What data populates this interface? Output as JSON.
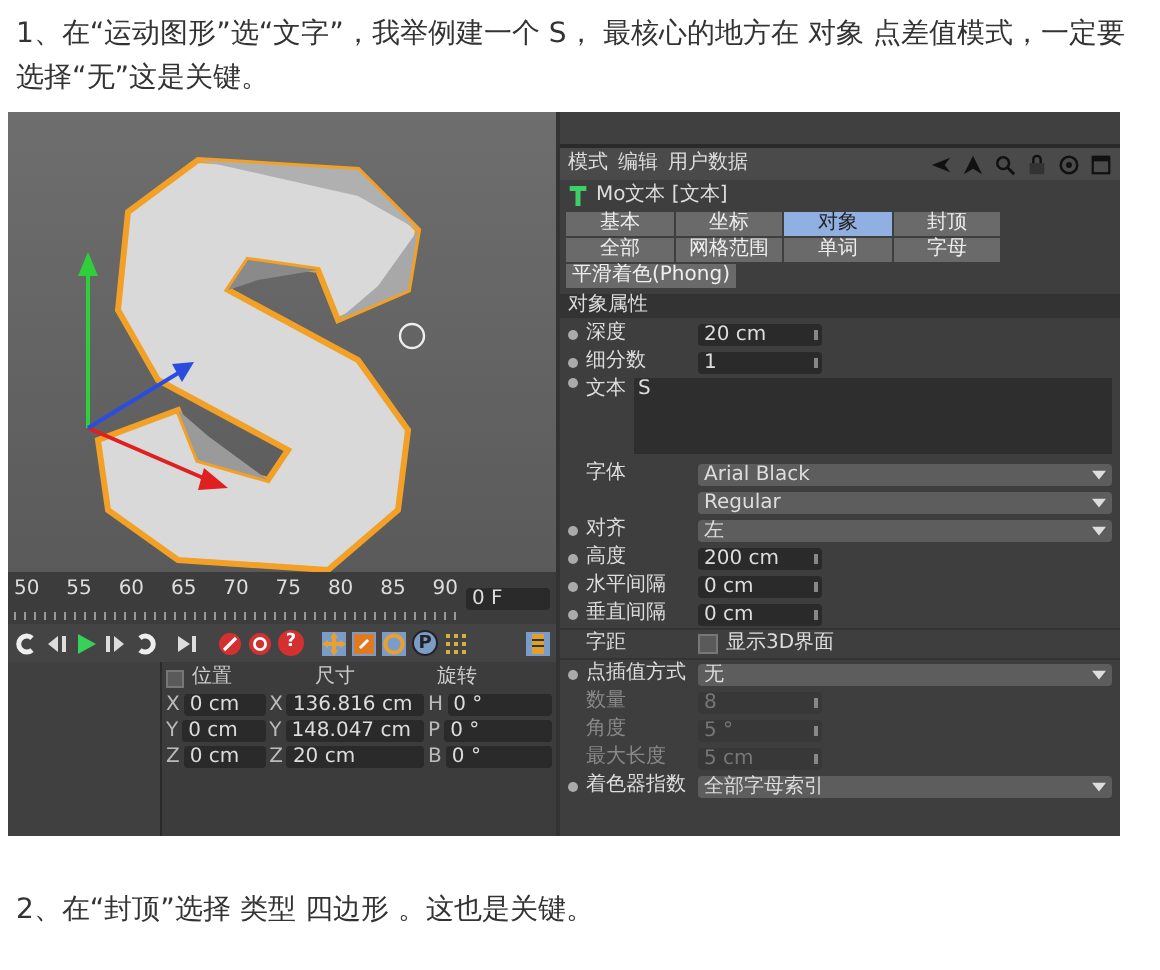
{
  "intro": "1、在“运动图形”选“文字”，我举例建一个 S， 最核心的地方在 对象 点差值模式，一定要选择“无”这是关键。",
  "timeline": {
    "ticks": [
      "50",
      "55",
      "60",
      "65",
      "70",
      "75",
      "80",
      "85",
      "90"
    ],
    "frame": "0 F"
  },
  "transport": {
    "help": "?",
    "param": "P"
  },
  "coords": {
    "checked": false,
    "headers": [
      "位置",
      "尺寸",
      "旋转"
    ],
    "rows": [
      [
        {
          "axis": "X",
          "value": "0 cm"
        },
        {
          "axis": "X",
          "value": "136.816 cm"
        },
        {
          "axis": "H",
          "value": "0 °"
        }
      ],
      [
        {
          "axis": "Y",
          "value": "0 cm"
        },
        {
          "axis": "Y",
          "value": "148.047 cm"
        },
        {
          "axis": "P",
          "value": "0 °"
        }
      ],
      [
        {
          "axis": "Z",
          "value": "0 cm"
        },
        {
          "axis": "Z",
          "value": "20 cm"
        },
        {
          "axis": "B",
          "value": "0 °"
        }
      ]
    ]
  },
  "attributes": {
    "menu": [
      "模式",
      "编辑",
      "用户数据"
    ],
    "object_title": "Mo文本 [文本]",
    "tabs": [
      {
        "label": "基本",
        "selected": false
      },
      {
        "label": "坐标",
        "selected": false
      },
      {
        "label": "对象",
        "selected": true
      },
      {
        "label": "封顶",
        "selected": false
      },
      {
        "label": "全部",
        "selected": false
      },
      {
        "label": "网格范围",
        "selected": false
      },
      {
        "label": "单词",
        "selected": false
      },
      {
        "label": "字母",
        "selected": false
      }
    ],
    "extra_tab": {
      "label": "平滑着色(Phong)",
      "selected": false
    },
    "section": "对象属性",
    "rows": [
      {
        "kind": "number",
        "label": "深度",
        "value": "20 cm",
        "dot": true,
        "disabled": false
      },
      {
        "kind": "number",
        "label": "细分数",
        "value": "1",
        "dot": true,
        "disabled": false
      },
      {
        "kind": "text",
        "label": "文本",
        "value": "S",
        "dot": true
      },
      {
        "kind": "dropdown",
        "label": "字体",
        "value": "Arial Black",
        "dot": false,
        "disabled": false
      },
      {
        "kind": "dropdown",
        "label": "",
        "value": "Regular",
        "dot": false,
        "disabled": false
      },
      {
        "kind": "dropdown",
        "label": "对齐",
        "value": "左",
        "dot": true,
        "disabled": false
      },
      {
        "kind": "number",
        "label": "高度",
        "value": "200 cm",
        "dot": true,
        "disabled": false
      },
      {
        "kind": "number",
        "label": "水平间隔",
        "value": "0 cm",
        "dot": true,
        "disabled": false
      },
      {
        "kind": "number",
        "label": "垂直间隔",
        "value": "0 cm",
        "dot": true,
        "disabled": false
      },
      {
        "kind": "checkbox",
        "label": "字距",
        "value": "显示3D界面",
        "checked": false
      },
      {
        "kind": "dropdown",
        "label": "点插值方式",
        "value": "无",
        "dot": true,
        "disabled": false
      },
      {
        "kind": "number",
        "label": "数量",
        "value": "8",
        "dot": false,
        "disabled": true
      },
      {
        "kind": "number",
        "label": "角度",
        "value": "5 °",
        "dot": false,
        "disabled": true
      },
      {
        "kind": "number",
        "label": "最大长度",
        "value": "5 cm",
        "dot": false,
        "disabled": true
      },
      {
        "kind": "dropdown",
        "label": "着色器指数",
        "value": "全部字母索引",
        "dot": true,
        "disabled": false
      }
    ]
  },
  "outro": "2、在“封顶”选择 类型 四边形 。这也是关键。"
}
